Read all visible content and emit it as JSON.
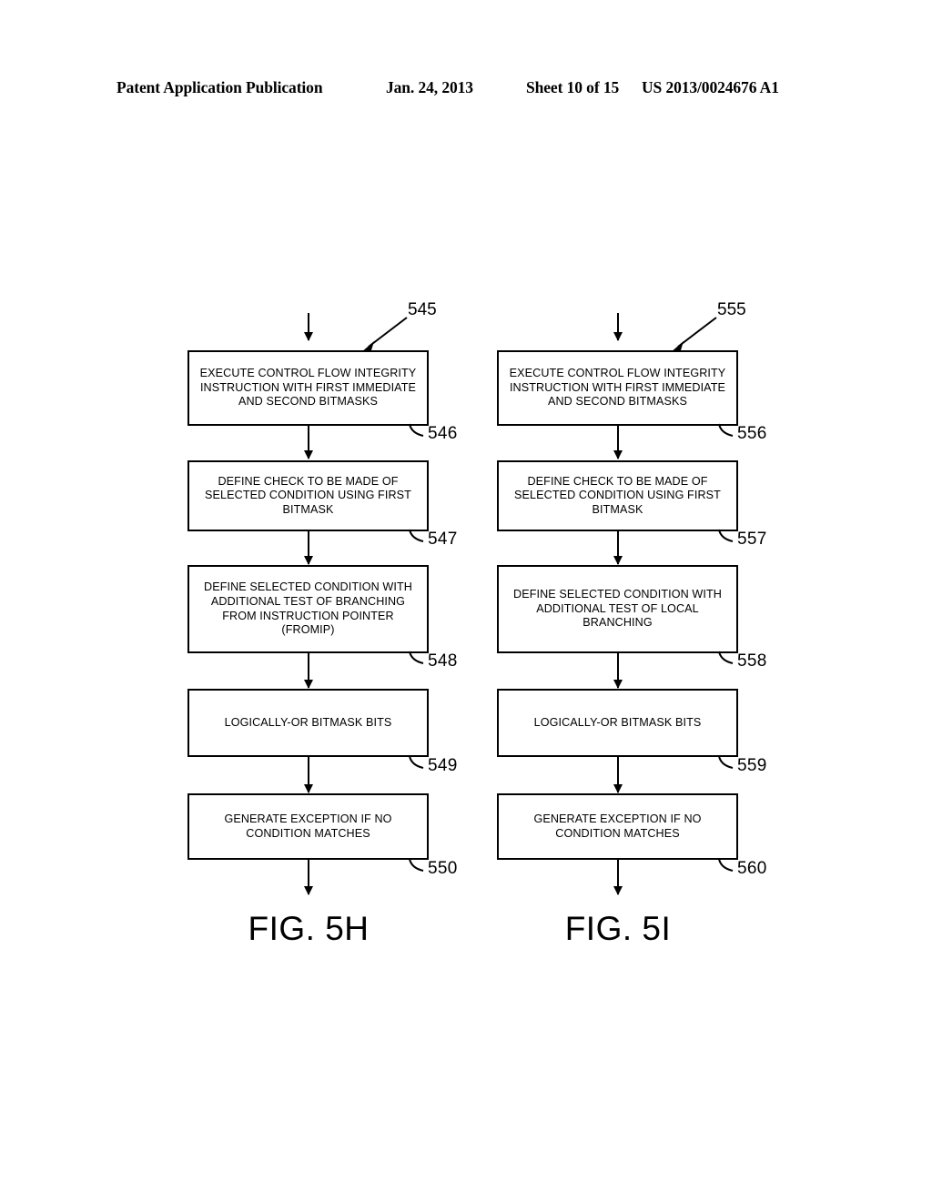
{
  "header": {
    "publication": "Patent Application Publication",
    "date": "Jan. 24, 2013",
    "sheet": "Sheet 10 of 15",
    "doc_number": "US 2013/0024676 A1"
  },
  "figures": [
    {
      "caption": "FIG. 5H",
      "entry_ref": "545",
      "nodes": [
        {
          "text": "EXECUTE CONTROL FLOW INTEGRITY INSTRUCTION WITH FIRST IMMEDIATE AND SECOND BITMASKS",
          "ref": "546"
        },
        {
          "text": "DEFINE CHECK TO BE MADE OF SELECTED CONDITION USING FIRST BITMASK",
          "ref": "547"
        },
        {
          "text": "DEFINE SELECTED CONDITION WITH ADDITIONAL TEST OF BRANCHING FROM INSTRUCTION POINTER (FROMIP)",
          "ref": "548"
        },
        {
          "text": "LOGICALLY-OR BITMASK BITS",
          "ref": "549"
        },
        {
          "text": "GENERATE EXCEPTION IF NO CONDITION MATCHES",
          "ref": "550"
        }
      ]
    },
    {
      "caption": "FIG. 5I",
      "entry_ref": "555",
      "nodes": [
        {
          "text": "EXECUTE CONTROL FLOW INTEGRITY INSTRUCTION WITH FIRST IMMEDIATE AND SECOND BITMASKS",
          "ref": "556"
        },
        {
          "text": "DEFINE CHECK TO BE MADE OF SELECTED CONDITION USING FIRST BITMASK",
          "ref": "557"
        },
        {
          "text": "DEFINE SELECTED CONDITION WITH ADDITIONAL TEST OF LOCAL BRANCHING",
          "ref": "558"
        },
        {
          "text": "LOGICALLY-OR BITMASK BITS",
          "ref": "559"
        },
        {
          "text": "GENERATE EXCEPTION IF NO CONDITION MATCHES",
          "ref": "560"
        }
      ]
    }
  ],
  "colors": {
    "ink": "#000000",
    "paper": "#ffffff"
  }
}
